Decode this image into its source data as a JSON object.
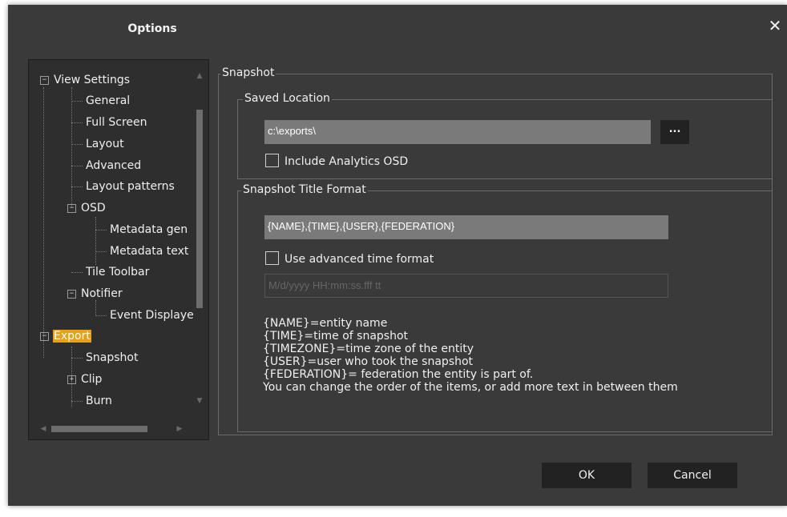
{
  "dialog": {
    "title": "Options",
    "close_glyph": "✕"
  },
  "tree": {
    "items": [
      {
        "label": "View Settings",
        "expander": "−"
      },
      {
        "label": "General"
      },
      {
        "label": "Full Screen"
      },
      {
        "label": "Layout"
      },
      {
        "label": "Advanced"
      },
      {
        "label": "Layout patterns"
      },
      {
        "label": "OSD",
        "expander": "−"
      },
      {
        "label": "Metadata gen"
      },
      {
        "label": "Metadata text"
      },
      {
        "label": "Tile Toolbar"
      },
      {
        "label": "Notifier",
        "expander": "−"
      },
      {
        "label": "Event Displaye"
      },
      {
        "label": "Export",
        "expander": "−",
        "selected": true
      },
      {
        "label": "Snapshot"
      },
      {
        "label": "Clip",
        "expander": "+"
      },
      {
        "label": "Burn"
      }
    ],
    "selected_color": "#e8a014"
  },
  "snapshot": {
    "legend": "Snapshot",
    "saved_location": {
      "legend": "Saved Location",
      "path_value": "c:\\exports\\",
      "browse_label": "...",
      "include_osd_label": "Include Analytics OSD",
      "include_osd_checked": false
    },
    "title_format": {
      "legend": "Snapshot Title Format",
      "format_value": "{NAME},{TIME},{USER},{FEDERATION}",
      "advanced_time_label": "Use advanced time format",
      "advanced_time_checked": false,
      "time_format_placeholder": "M/d/yyyy HH:mm:ss.fff tt"
    },
    "help_lines": [
      "{NAME}=entity name",
      "{TIME}=time of snapshot",
      "{TIMEZONE}=time zone of the entity",
      "{USER}=user who took the snapshot",
      "{FEDERATION}= federation the entity is part of.",
      "You can change the order of the items, or add more text in between them"
    ]
  },
  "buttons": {
    "ok_label": "OK",
    "cancel_label": "Cancel"
  }
}
